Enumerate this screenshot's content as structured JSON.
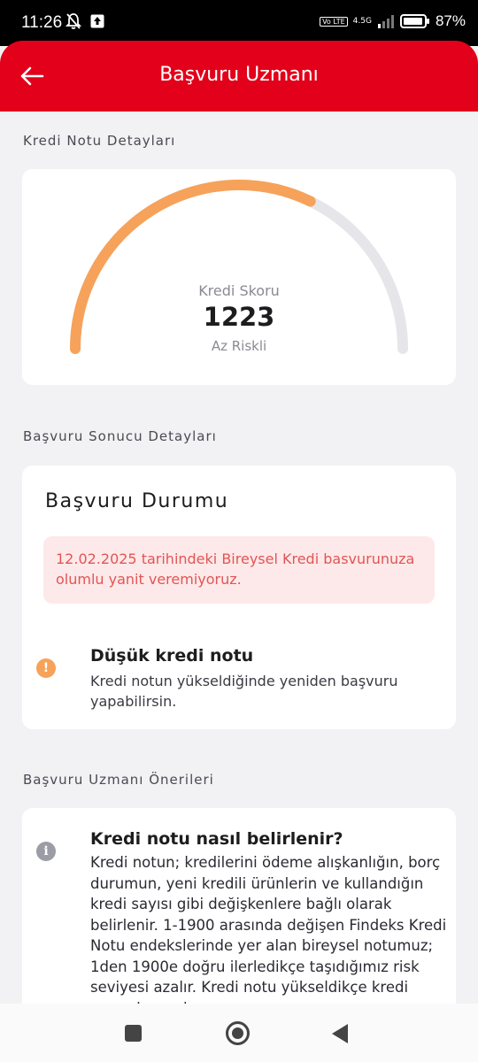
{
  "status_bar": {
    "time": "11:26",
    "volte": "Vo LTE",
    "network": "4.5G",
    "battery": "87%"
  },
  "header": {
    "title": "Başvuru Uzmanı",
    "back_icon": "arrow-left-icon"
  },
  "credit_section": {
    "label": "Kredi Notu Detayları",
    "gauge": {
      "title": "Kredi Skoru",
      "score": "1223",
      "risk": "Az Riskli",
      "score_value": 1223,
      "score_max": 1900,
      "fill_color": "#f6a25a",
      "track_color": "#e6e6ea"
    }
  },
  "result_section": {
    "label": "Başvuru Sonucu Detayları",
    "card_title": "Başvuru Durumu",
    "alert": "12.02.2025 tarihindeki Bireysel Kredi basvurunuza olumlu yanit veremiyoruz.",
    "reason": {
      "icon": "warning-icon",
      "icon_glyph": "!",
      "title": "Düşük kredi notu",
      "text": "Kredi notun yükseldiğinde yeniden başvuru yapabilirsin."
    }
  },
  "advice_section": {
    "label": "Başvuru Uzmanı Önerileri",
    "item": {
      "icon": "info-icon",
      "icon_glyph": "i",
      "title": "Kredi notu nasıl belirlenir?",
      "text": "Kredi notun; kredilerini ödeme alışkanlığın, borç durumun, yeni kredili ürünlerin ve kullandığın kredi sayısı gibi değişkenlere bağlı olarak belirlenir. 1-1900 arasında değişen Findeks Kredi Notu endekslerinde yer alan bireysel notumuz; 1den 1900e doğru ilerledikçe taşıdığımız risk seviyesi azalır. Kredi notu yükseldikçe kredi veren kurumlar"
    }
  },
  "colors": {
    "brand": "#e2001a",
    "warning": "#f6a25a",
    "alert_text": "#e25555",
    "alert_bg": "#fde9e9"
  }
}
